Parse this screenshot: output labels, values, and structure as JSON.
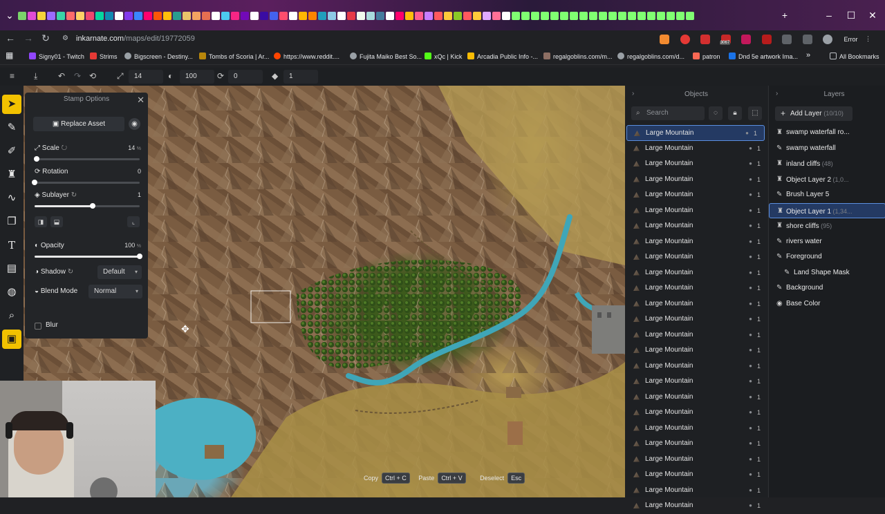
{
  "browser": {
    "url_domain": "inkarnate.com",
    "url_path": "/maps/edit/19772059",
    "error_label": "Error",
    "ext_badge": "3067",
    "bookmarks": [
      "Signy01 - Twitch",
      "Strims",
      "Bigscreen - Destiny...",
      "Tombs of Scoria | Ar...",
      "https://www.reddit....",
      "Fujita Maiko Best So...",
      "xQc | Kick",
      "Arcadia Public Info -...",
      "regalgoblins.com/m...",
      "regalgoblins.com/d...",
      "patron",
      "Dnd 5e artwork Ima..."
    ],
    "all_bookmarks": "All Bookmarks",
    "overflow": "»"
  },
  "toolbar": {
    "brush_size": "14",
    "opacity": "100",
    "rotation": "0",
    "layers_count": "1"
  },
  "stamp_options": {
    "title": "Stamp Options",
    "replace_asset": "Replace Asset",
    "scale_label": "Scale",
    "scale_value": "14",
    "scale_unit": "%",
    "scale_fraction": 0.02,
    "rotation_label": "Rotation",
    "rotation_value": "0",
    "rotation_fraction": 0.0,
    "sublayer_label": "Sublayer",
    "sublayer_value": "1",
    "sublayer_fraction": 0.55,
    "opacity_label": "Opacity",
    "opacity_value": "100",
    "opacity_unit": "%",
    "opacity_fraction": 1.0,
    "shadow_label": "Shadow",
    "shadow_value": "Default",
    "blend_label": "Blend Mode",
    "blend_value": "Normal",
    "blur_label": "Blur"
  },
  "hints": {
    "copy": "Copy",
    "copy_key": "Ctrl + C",
    "paste": "Paste",
    "paste_key": "Ctrl + V",
    "deselect": "Deselect",
    "deselect_key": "Esc"
  },
  "objects": {
    "title": "Objects",
    "search_placeholder": "Search",
    "items": [
      "Large Mountain",
      "Large Mountain",
      "Large Mountain",
      "Large Mountain",
      "Large Mountain",
      "Large Mountain",
      "Large Mountain",
      "Large Mountain",
      "Large Mountain",
      "Large Mountain",
      "Large Mountain",
      "Large Mountain",
      "Large Mountain",
      "Large Mountain",
      "Large Mountain",
      "Large Mountain",
      "Large Mountain",
      "Large Mountain",
      "Large Mountain",
      "Large Mountain",
      "Large Mountain",
      "Large Mountain",
      "Large Mountain",
      "Large Mountain",
      "Large Mountain"
    ],
    "item_count": "1"
  },
  "layers": {
    "title": "Layers",
    "add_layer": "Add Layer",
    "add_layer_cap": "(10/10)",
    "items": [
      {
        "name": "swamp waterfall ro...",
        "sub": "",
        "icon": "object"
      },
      {
        "name": "swamp waterfall",
        "sub": "",
        "icon": "brush"
      },
      {
        "name": "inland cliffs",
        "sub": "(48)",
        "icon": "object"
      },
      {
        "name": "Object Layer 2",
        "sub": "(1,0...",
        "icon": "object"
      },
      {
        "name": "Brush Layer 5",
        "sub": "",
        "icon": "brush"
      },
      {
        "name": "Object Layer 1",
        "sub": "(1,34...",
        "icon": "object"
      },
      {
        "name": "shore cliffs",
        "sub": "(95)",
        "icon": "object"
      },
      {
        "name": "rivers water",
        "sub": "",
        "icon": "brush"
      },
      {
        "name": "Foreground",
        "sub": "",
        "icon": "brush"
      },
      {
        "name": "Land Shape Mask",
        "sub": "",
        "icon": "brush"
      },
      {
        "name": "Background",
        "sub": "",
        "icon": "brush"
      },
      {
        "name": "Base Color",
        "sub": "",
        "icon": "palette"
      }
    ]
  },
  "colors": {
    "accent": "#f2c200",
    "selection": "#5b8fe0",
    "river": "#3fa6b8",
    "forest": "#3b5a1e"
  }
}
